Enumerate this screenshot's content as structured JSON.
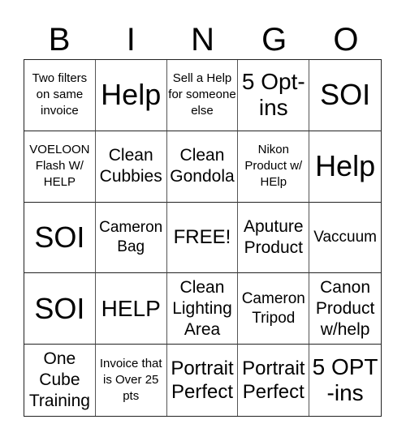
{
  "header": [
    "B",
    "I",
    "N",
    "G",
    "O"
  ],
  "cells": [
    {
      "text": "Two filters on same invoice",
      "size": "s15"
    },
    {
      "text": "Help",
      "size": "s36"
    },
    {
      "text": "Sell a Help for someone else",
      "size": "s15"
    },
    {
      "text": "5 Opt-ins",
      "size": "s28"
    },
    {
      "text": "SOI",
      "size": "s36"
    },
    {
      "text": "VOELOON Flash W/ HELP",
      "size": "s15"
    },
    {
      "text": "Clean Cubbies",
      "size": "s21"
    },
    {
      "text": "Clean Gondola",
      "size": "s21"
    },
    {
      "text": "Nikon Product w/ HElp",
      "size": "s15"
    },
    {
      "text": "Help",
      "size": "s36"
    },
    {
      "text": "SOI",
      "size": "s36"
    },
    {
      "text": "Cameron Bag",
      "size": "s19"
    },
    {
      "text": "FREE!",
      "size": "s24"
    },
    {
      "text": "Aputure Product",
      "size": "s21"
    },
    {
      "text": "Vaccuum",
      "size": "s19"
    },
    {
      "text": "SOI",
      "size": "s36"
    },
    {
      "text": "HELP",
      "size": "s28"
    },
    {
      "text": "Clean Lighting Area",
      "size": "s21"
    },
    {
      "text": "Cameron Tripod",
      "size": "s19"
    },
    {
      "text": "Canon Product w/help",
      "size": "s21"
    },
    {
      "text": "One Cube Training",
      "size": "s21"
    },
    {
      "text": "Invoice that is Over 25 pts",
      "size": "s15"
    },
    {
      "text": "Portrait Perfect",
      "size": "s24"
    },
    {
      "text": "Portrait Perfect",
      "size": "s24"
    },
    {
      "text": "5 OPT -ins",
      "size": "s28"
    }
  ]
}
